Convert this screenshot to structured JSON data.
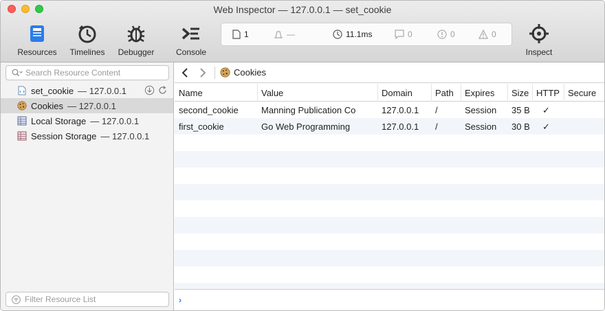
{
  "window": {
    "title": "Web Inspector — 127.0.0.1 — set_cookie"
  },
  "toolbar": {
    "tabs": [
      {
        "label": "Resources",
        "icon": "resources-icon",
        "active": true
      },
      {
        "label": "Timelines",
        "icon": "timelines-icon"
      },
      {
        "label": "Debugger",
        "icon": "debugger-icon"
      },
      {
        "label": "Console",
        "icon": "console-icon"
      }
    ],
    "inspect_label": "Inspect",
    "dashboard": {
      "resources_count": "1",
      "resources_size": "—",
      "load_time": "11.1ms",
      "logs": "0",
      "errors": "0",
      "warnings": "0"
    }
  },
  "sidebar": {
    "search_placeholder": "Search Resource Content",
    "filter_placeholder": "Filter Resource List",
    "items": [
      {
        "label": "set_cookie",
        "sub": "— 127.0.0.1",
        "icon": "document-icon"
      },
      {
        "label": "Cookies",
        "sub": "— 127.0.0.1",
        "icon": "cookie-icon",
        "selected": true
      },
      {
        "label": "Local Storage",
        "sub": "— 127.0.0.1",
        "icon": "local-storage-icon"
      },
      {
        "label": "Session Storage",
        "sub": "— 127.0.0.1",
        "icon": "session-storage-icon"
      }
    ]
  },
  "content": {
    "breadcrumb": "Cookies",
    "table": {
      "columns": [
        "Name",
        "Value",
        "Domain",
        "Path",
        "Expires",
        "Size",
        "HTTP",
        "Secure"
      ],
      "rows": [
        {
          "name": "second_cookie",
          "value": "Manning Publication Co",
          "domain": "127.0.0.1",
          "path": "/",
          "expires": "Session",
          "size": "35 B",
          "http": "✓",
          "secure": ""
        },
        {
          "name": "first_cookie",
          "value": "Go Web Programming",
          "domain": "127.0.0.1",
          "path": "/",
          "expires": "Session",
          "size": "30 B",
          "http": "✓",
          "secure": ""
        }
      ]
    },
    "console_prompt": "›"
  },
  "colors": {
    "accent": "#2b7de9",
    "selected_row": "#d9d9d9",
    "stripe": "#f2f6fb"
  }
}
